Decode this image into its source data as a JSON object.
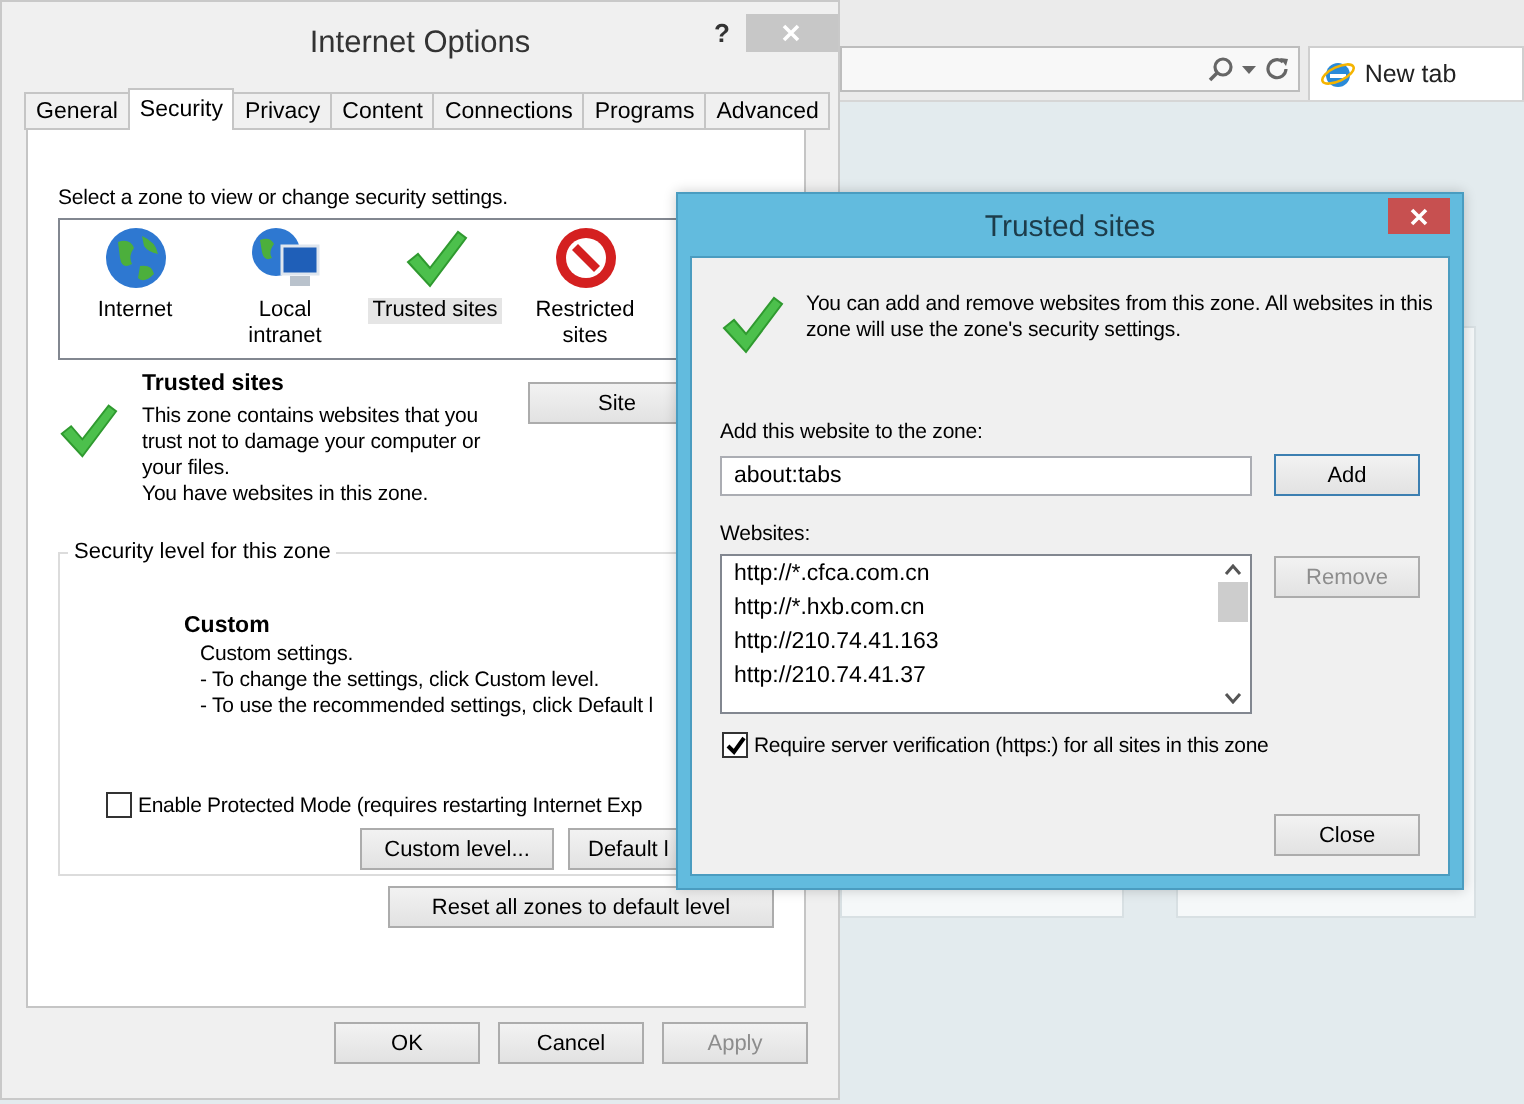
{
  "browser": {
    "new_tab": {
      "label": "New tab"
    }
  },
  "internet_options": {
    "title": "Internet Options",
    "help": "?",
    "tabs": [
      {
        "label": "General",
        "selected": false
      },
      {
        "label": "Security",
        "selected": true
      },
      {
        "label": "Privacy",
        "selected": false
      },
      {
        "label": "Content",
        "selected": false
      },
      {
        "label": "Connections",
        "selected": false
      },
      {
        "label": "Programs",
        "selected": false
      },
      {
        "label": "Advanced",
        "selected": false
      }
    ],
    "zone_prompt": "Select a zone to view or change security settings.",
    "zones": [
      {
        "label": "Internet",
        "kind": "internet",
        "selected": false
      },
      {
        "label": "Local intranet",
        "kind": "intranet",
        "selected": false
      },
      {
        "label": "Trusted sites",
        "kind": "trusted",
        "selected": true
      },
      {
        "label": "Restricted sites",
        "kind": "restricted",
        "selected": false
      }
    ],
    "zone_info": {
      "title": "Trusted sites",
      "description": "This zone contains websites that you trust not to damage your computer or your files.",
      "status": "You have websites in this zone."
    },
    "sites_button": "Site",
    "security_level": {
      "legend": "Security level for this zone",
      "level_name": "Custom",
      "details": [
        "Custom settings.",
        "- To change the settings, click Custom level.",
        "- To use the recommended settings, click Default l"
      ]
    },
    "protected_mode": {
      "label": "Enable Protected Mode (requires restarting Internet Exp",
      "checked": false
    },
    "level_buttons": [
      "Custom level...",
      "Default l"
    ],
    "reset_button": "Reset all zones to default level",
    "buttons": [
      {
        "label": "OK",
        "disabled": false
      },
      {
        "label": "Cancel",
        "disabled": false
      },
      {
        "label": "Apply",
        "disabled": true
      }
    ]
  },
  "trusted_sites_dialog": {
    "title": "Trusted sites",
    "intro": "You can add and remove websites from this zone. All websites in this zone will use the zone's security settings.",
    "add_label": "Add this website to the zone:",
    "add_value": "about:tabs",
    "add_button": {
      "label": "Add",
      "disabled": false
    },
    "websites_label": "Websites:",
    "websites": [
      "http://*.cfca.com.cn",
      "http://*.hxb.com.cn",
      "http://210.74.41.163",
      "http://210.74.41.37"
    ],
    "remove_button": {
      "label": "Remove",
      "disabled": true
    },
    "require_https": {
      "label": "Require server verification (https:) for all sites in this zone",
      "checked": true
    },
    "close_button": "Close"
  }
}
